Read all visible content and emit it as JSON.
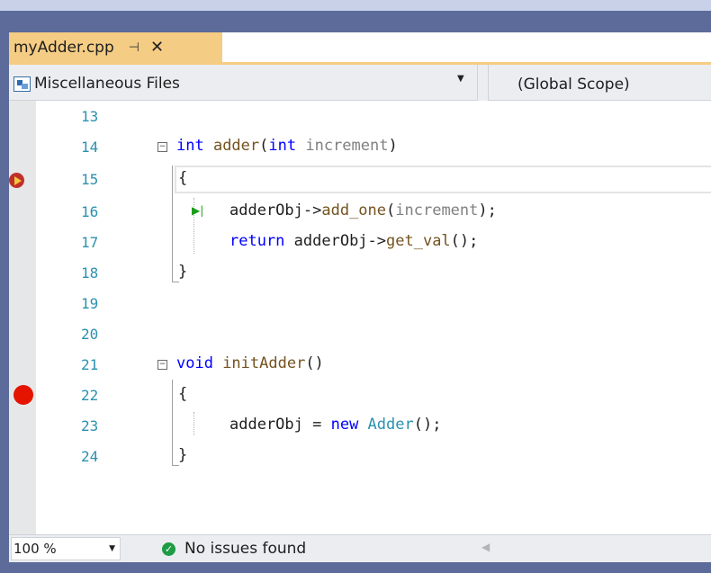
{
  "tab": {
    "filename": "myAdder.cpp",
    "pin_glyph": "⊣",
    "close_glyph": "✕"
  },
  "navbar": {
    "project": "Miscellaneous Files",
    "scope": "(Global Scope)"
  },
  "editor": {
    "lines": [
      {
        "num": "13"
      },
      {
        "num": "14"
      },
      {
        "num": "15"
      },
      {
        "num": "16"
      },
      {
        "num": "17"
      },
      {
        "num": "18"
      },
      {
        "num": "19"
      },
      {
        "num": "20"
      },
      {
        "num": "21"
      },
      {
        "num": "22"
      },
      {
        "num": "23"
      },
      {
        "num": "24"
      }
    ],
    "code": {
      "l14_kw1": "int",
      "l14_fn": " adder",
      "l14_p1": "(",
      "l14_kw2": "int",
      "l14_param": " increment",
      "l14_p2": ")",
      "l15": "{",
      "l16_a": "adderObj->",
      "l16_fn": "add_one",
      "l16_b": "(",
      "l16_param": "increment",
      "l16_c": ");",
      "l17_kw": "return",
      "l17_a": " adderObj->",
      "l17_fn": "get_val",
      "l17_b": "();",
      "l18": "}",
      "l21_kw": "void",
      "l21_fn": " initAdder",
      "l21_a": "()",
      "l22": "{",
      "l23_a": "adderObj = ",
      "l23_kw": "new",
      "l23_typ": " Adder",
      "l23_b": "();",
      "l24": "}"
    },
    "colors": {
      "keyword": "#0000ff",
      "function": "#74531f",
      "parameter": "#808080",
      "type": "#2b91af",
      "line_number": "#2b91af",
      "breakpoint": "#e51400",
      "tab_active": "#f5cc84"
    }
  },
  "statusbar": {
    "zoom": "100 %",
    "message": "No issues found"
  }
}
